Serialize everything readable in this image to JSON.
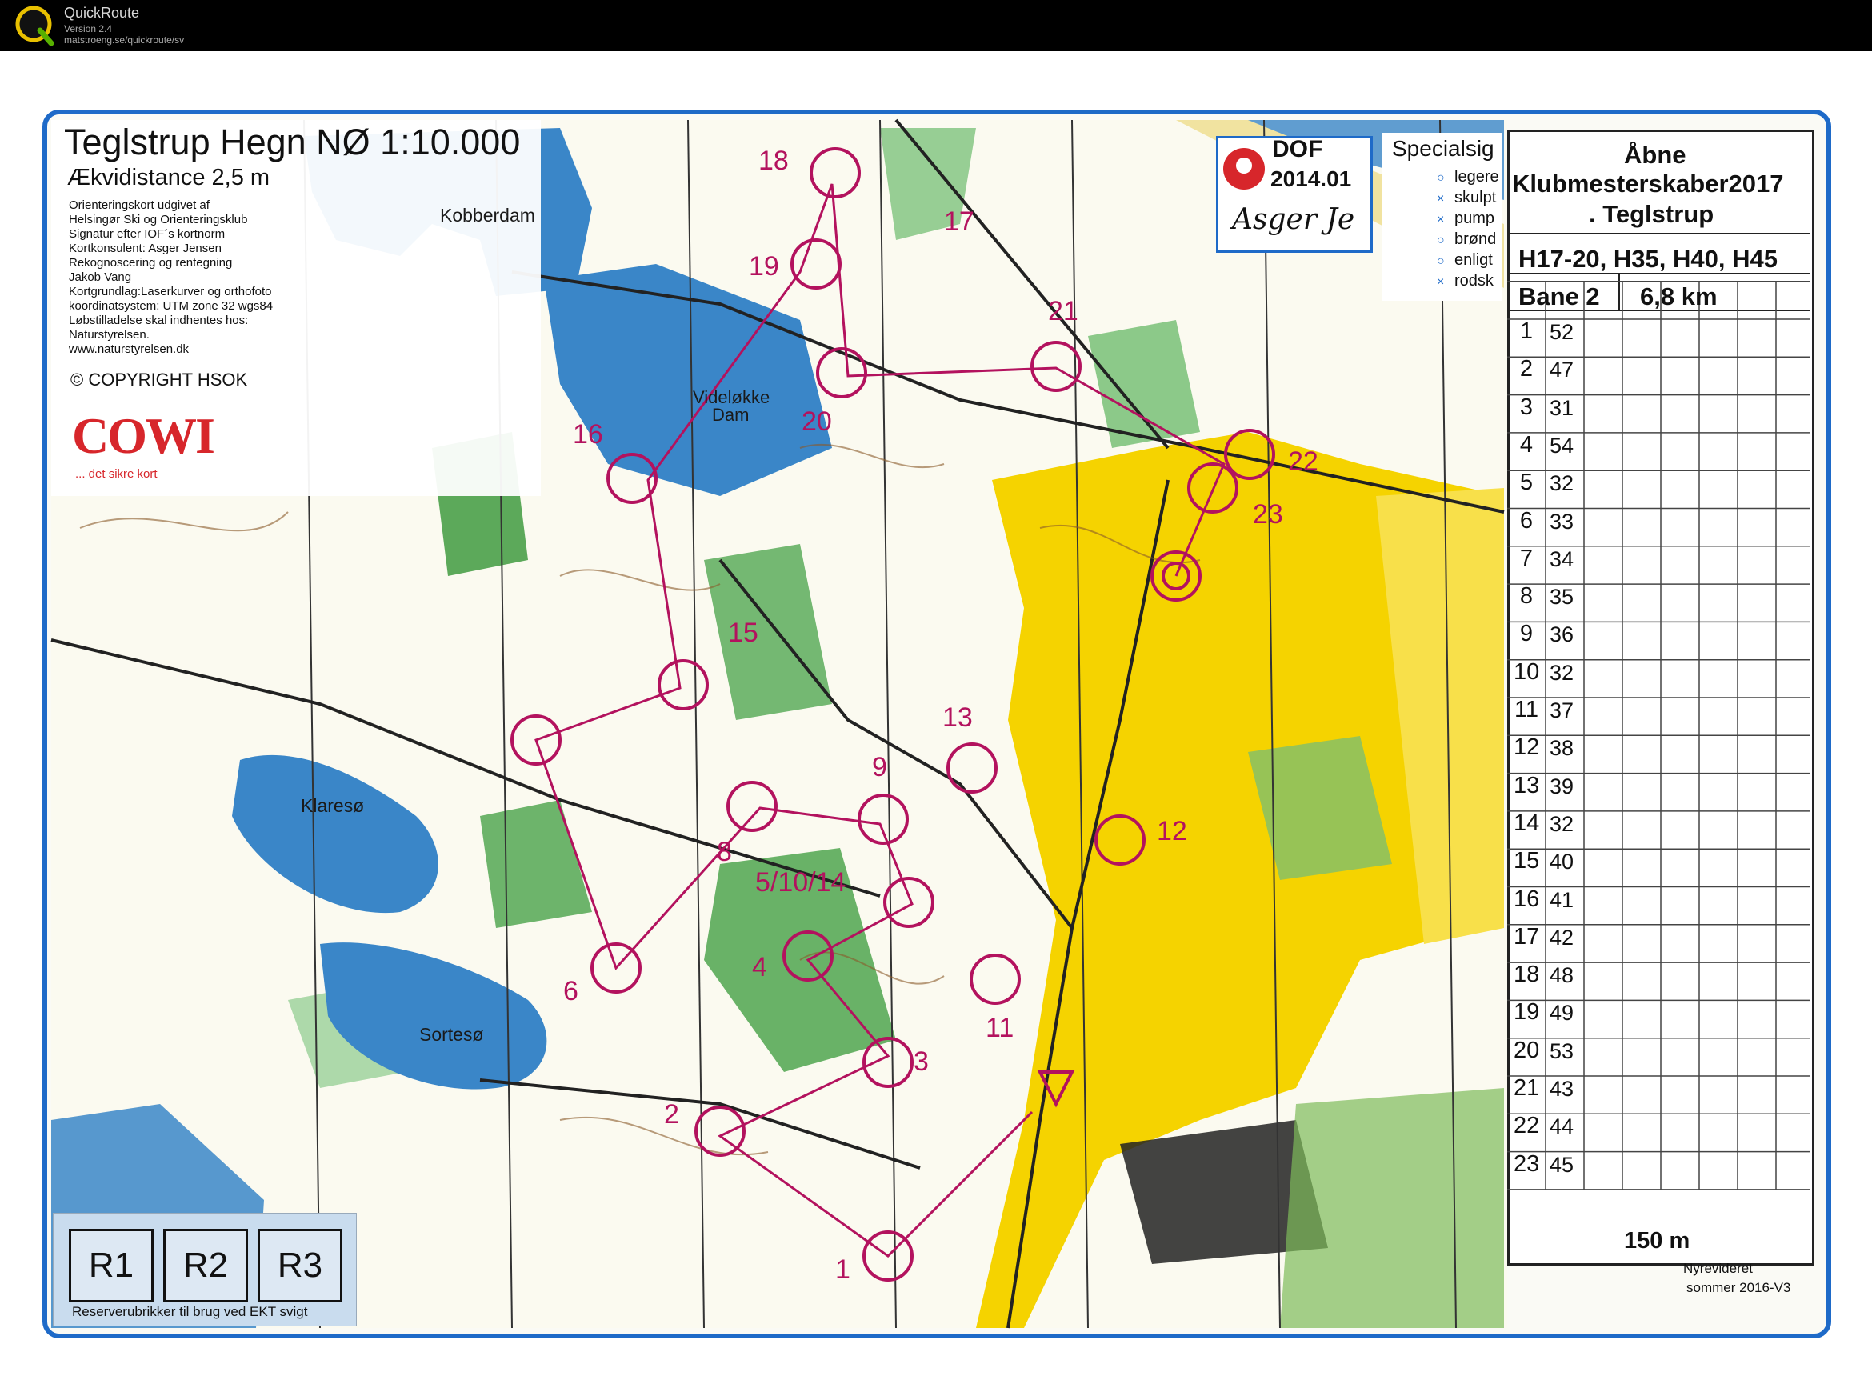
{
  "app": {
    "title": "QuickRoute",
    "version": "Version 2.4",
    "url": "matstroeng.se/quickroute/sv"
  },
  "map": {
    "title": "Teglstrup Hegn NØ 1:10.000",
    "equidistance": "Ækvidistance 2,5  m",
    "info_lines": [
      "Orienteringskort udgivet af",
      "Helsingør Ski og Orienteringsklub",
      "Signatur efter IOF´s kortnorm",
      "Kortkonsulent: Asger Jensen",
      "Rekognoscering og rentegning",
      "Jakob Vang",
      "Kortgrundlag:Laserkurver og orthofoto",
      "koordinatsystem: UTM zone 32 wgs84",
      "Løbstilladelse skal indhentes hos:",
      "Naturstyrelsen.",
      "www.naturstyrelsen.dk"
    ],
    "copyright": "COPYRIGHT HSOK",
    "cowi": "COWI",
    "cowi_tagline": "... det sikre kort",
    "lakes": [
      "Kobberdam",
      "Videløkke",
      "Dam",
      "Klaresø",
      "Sortesø"
    ],
    "dof": {
      "line1": "DOF",
      "line2": "2014.01",
      "signature": "Asger Je"
    },
    "special": {
      "title": "Specialsig",
      "items": [
        "legere",
        "skulpt",
        "pump",
        "brønd",
        "enligt",
        "rodsk"
      ],
      "symbols": [
        "○",
        "×",
        "×",
        "○",
        "○",
        "×"
      ]
    },
    "reserve": {
      "boxes": [
        "R1",
        "R2",
        "R3"
      ],
      "text": "Reserverubrikker til brug ved EKT svigt"
    },
    "control_numbers": [
      "18",
      "17",
      "19",
      "21",
      "16",
      "20",
      "22",
      "23",
      "15",
      "13",
      "9",
      "12",
      "8",
      "5/10/14",
      "4",
      "6",
      "11",
      "3",
      "2",
      "1"
    ],
    "revision": [
      "Nyrevideret",
      "sommer 2016-V3"
    ]
  },
  "control_descriptions": {
    "title": [
      "Åbne",
      "Klubmesterskaber2017",
      ". Teglstrup"
    ],
    "classes": "H17-20, H35, H40, H45",
    "course": "Bane 2",
    "length": "6,8 km",
    "rows": [
      {
        "n": "1",
        "code": "52"
      },
      {
        "n": "2",
        "code": "47"
      },
      {
        "n": "3",
        "code": "31"
      },
      {
        "n": "4",
        "code": "54"
      },
      {
        "n": "5",
        "code": "32"
      },
      {
        "n": "6",
        "code": "33"
      },
      {
        "n": "7",
        "code": "34"
      },
      {
        "n": "8",
        "code": "35"
      },
      {
        "n": "9",
        "code": "36"
      },
      {
        "n": "10",
        "code": "32"
      },
      {
        "n": "11",
        "code": "37"
      },
      {
        "n": "12",
        "code": "38"
      },
      {
        "n": "13",
        "code": "39"
      },
      {
        "n": "14",
        "code": "32"
      },
      {
        "n": "15",
        "code": "40"
      },
      {
        "n": "16",
        "code": "41"
      },
      {
        "n": "17",
        "code": "42"
      },
      {
        "n": "18",
        "code": "48"
      },
      {
        "n": "19",
        "code": "49"
      },
      {
        "n": "20",
        "code": "53"
      },
      {
        "n": "21",
        "code": "43"
      },
      {
        "n": "22",
        "code": "44"
      },
      {
        "n": "23",
        "code": "45"
      }
    ],
    "finish_distance": "150 m"
  },
  "colors": {
    "course": "#b3125e",
    "water": "#3a86c8",
    "green": "#3f9a3f",
    "yellow": "#f5d300",
    "frame": "#1e6ac8"
  }
}
